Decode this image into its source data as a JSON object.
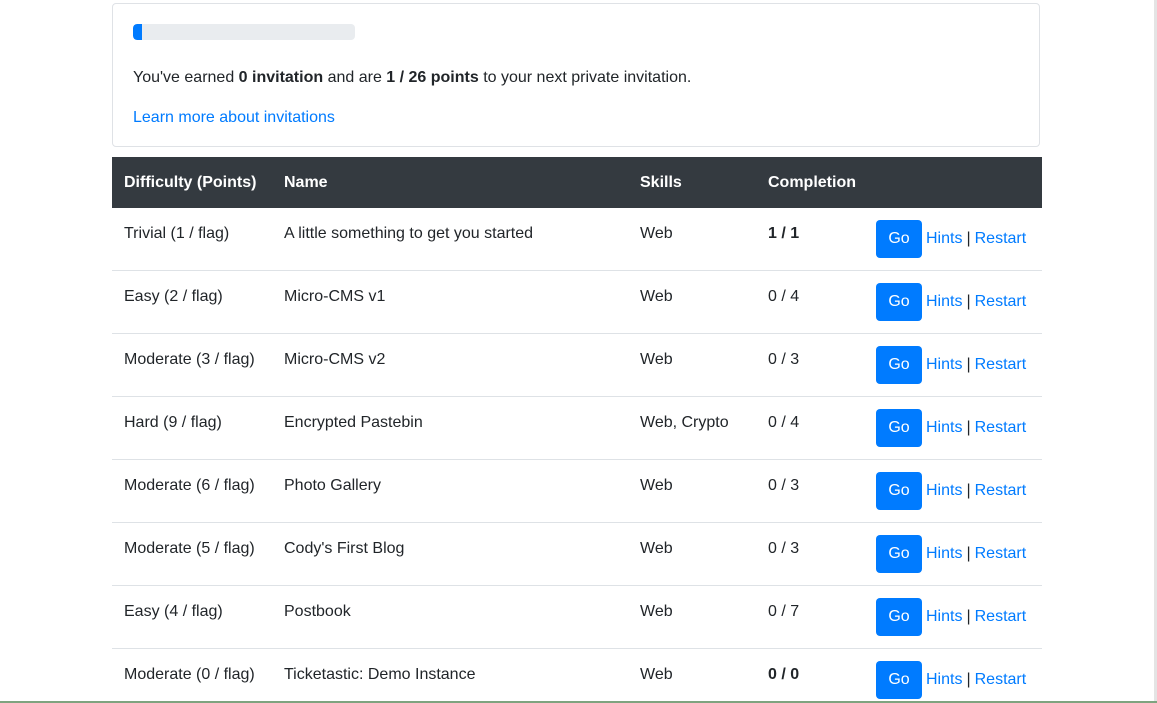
{
  "invitations": {
    "progress_fraction": 0.0385,
    "text_prefix": "You've earned ",
    "earned": "0 invitation",
    "text_middle": " and are ",
    "points": "1 / 26 points",
    "text_suffix": " to your next private invitation.",
    "learn_more": "Learn more about invitations"
  },
  "table": {
    "headers": {
      "difficulty": "Difficulty (Points)",
      "name": "Name",
      "skills": "Skills",
      "completion": "Completion"
    },
    "go_label": "Go",
    "hints_label": "Hints",
    "separator": "|",
    "restart_label": "Restart",
    "rows": [
      {
        "difficulty": "Trivial (1 / flag)",
        "name": "A little something to get you started",
        "skills": "Web",
        "completion": "1 / 1",
        "complete": true
      },
      {
        "difficulty": "Easy (2 / flag)",
        "name": "Micro-CMS v1",
        "skills": "Web",
        "completion": "0 / 4",
        "complete": false
      },
      {
        "difficulty": "Moderate (3 / flag)",
        "name": "Micro-CMS v2",
        "skills": "Web",
        "completion": "0 / 3",
        "complete": false
      },
      {
        "difficulty": "Hard (9 / flag)",
        "name": "Encrypted Pastebin",
        "skills": "Web, Crypto",
        "completion": "0 / 4",
        "complete": false
      },
      {
        "difficulty": "Moderate (6 / flag)",
        "name": "Photo Gallery",
        "skills": "Web",
        "completion": "0 / 3",
        "complete": false
      },
      {
        "difficulty": "Moderate (5 / flag)",
        "name": "Cody's First Blog",
        "skills": "Web",
        "completion": "0 / 3",
        "complete": false
      },
      {
        "difficulty": "Easy (4 / flag)",
        "name": "Postbook",
        "skills": "Web",
        "completion": "0 / 7",
        "complete": false
      },
      {
        "difficulty": "Moderate (0 / flag)",
        "name": "Ticketastic: Demo Instance",
        "skills": "Web",
        "completion": "0 / 0",
        "complete": true
      }
    ]
  }
}
